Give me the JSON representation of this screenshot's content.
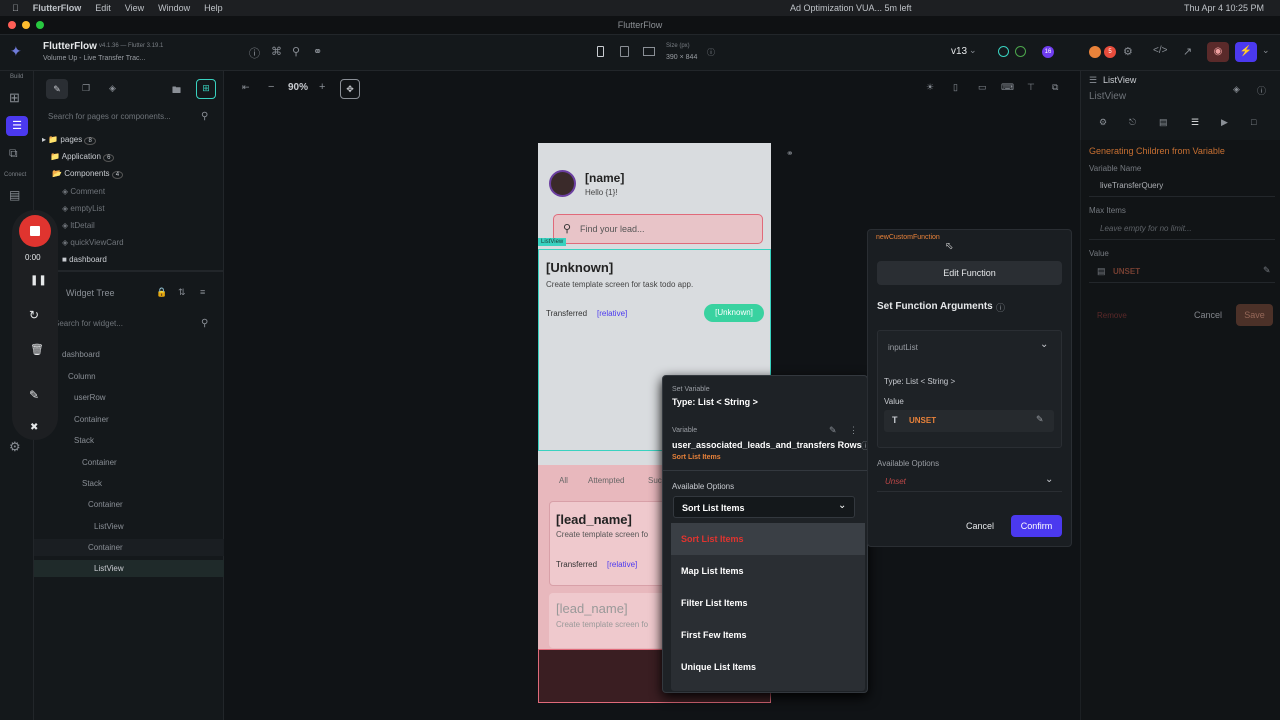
{
  "menubar": {
    "app": "FlutterFlow",
    "items": [
      "Edit",
      "View",
      "Window",
      "Help"
    ],
    "notification": "Ad Optimization VUA... 5m left",
    "datetime": "Thu Apr 4  10:25 PM"
  },
  "window": {
    "title": "FlutterFlow"
  },
  "project": {
    "name": "FlutterFlow",
    "version": "v4.1.36 — Flutter 3.19.1",
    "subtitle": "Volume Up - Live Transfer Trac..."
  },
  "toolbar": {
    "size_label": "Size (px)",
    "size_value": "390 × 844",
    "zoom": "90%",
    "version_tag": "v13",
    "badge_16": "16",
    "badge_5": "5"
  },
  "rail": {
    "build": "Build",
    "connect": "Connect"
  },
  "left": {
    "search_placeholder": "Search for pages or components...",
    "pages": "pages",
    "pages_count": "8",
    "application": "Application",
    "application_count": "6",
    "components": "Components",
    "components_count": "4",
    "component_items": [
      "Comment",
      "emptyList",
      "ltDetail",
      "quickViewCard",
      "dashboard"
    ],
    "widget_tree": "Widget Tree",
    "widget_search": "Search for widget...",
    "tree": [
      "dashboard",
      "Column",
      "userRow",
      "Container",
      "Stack",
      "Container",
      "Stack",
      "Container",
      "ListView",
      "Container",
      "ListView"
    ]
  },
  "recorder": {
    "time": "0:00"
  },
  "phone": {
    "name": "[name]",
    "hello": "Hello {1}!",
    "search_placeholder": "Find your lead...",
    "listview_tag": "ListView",
    "card1": {
      "title": "[Unknown]",
      "desc": "Create template screen for task todo app.",
      "status": "Transferred",
      "relative": "[relative]",
      "badge": "[Unknown]"
    },
    "tabs": [
      "All",
      "Attempted",
      "Suc"
    ],
    "card2": {
      "title": "[lead_name]",
      "desc": "Create template screen fo",
      "status": "Transferred",
      "relative": "[relative]"
    },
    "card3": {
      "title": "[lead_name]",
      "desc": "Create template screen fo"
    }
  },
  "setvar": {
    "label": "Set Variable",
    "type": "Type: List < String >",
    "variable_label": "Variable",
    "variable_name": "user_associated_leads_and_transfers Rows",
    "sort_tag": "Sort List Items",
    "available": "Available Options",
    "selected": "Sort List Items",
    "options": [
      "Sort List Items",
      "Map List Items",
      "Filter List Items",
      "First Few Items",
      "Unique List Items"
    ]
  },
  "fn": {
    "name": "newCustomFunction",
    "edit": "Edit Function",
    "args_title": "Set Function Arguments",
    "arg": "inputList",
    "type": "Type: List < String >",
    "value_label": "Value",
    "unset": "UNSET",
    "available": "Available Options",
    "unset_placeholder": "Unset",
    "cancel": "Cancel",
    "confirm": "Confirm"
  },
  "right": {
    "title": "ListView",
    "subtitle": "ListView",
    "section": "Generating Children from Variable",
    "var_label": "Variable Name",
    "var_value": "liveTransferQuery",
    "max_label": "Max Items",
    "max_placeholder": "Leave empty for no limit...",
    "value_label": "Value",
    "unset": "UNSET",
    "remove": "Remove",
    "cancel": "Cancel",
    "save": "Save"
  }
}
